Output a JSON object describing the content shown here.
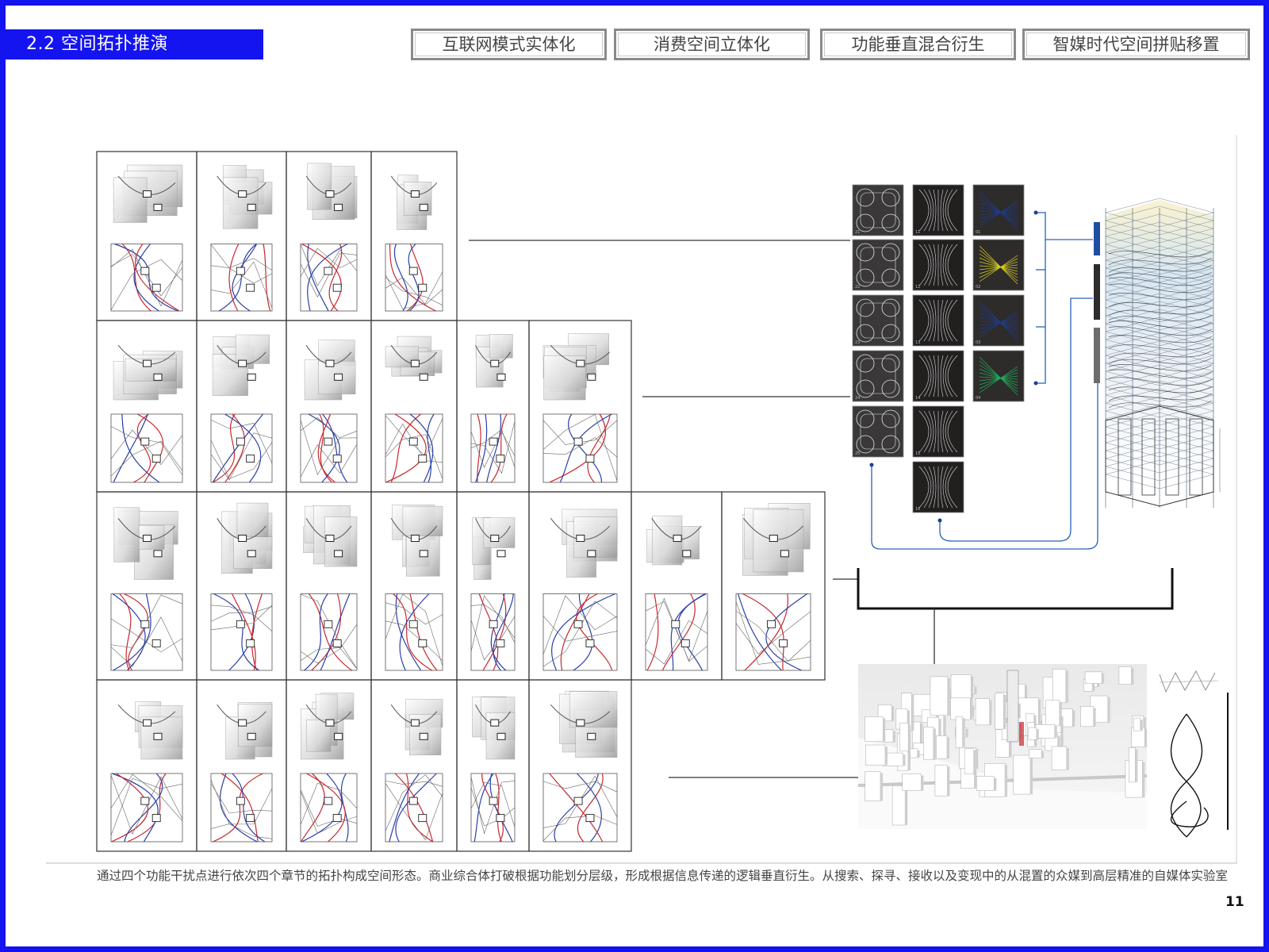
{
  "header": {
    "section_title": "2.2 空间拓扑推演",
    "tabs": [
      {
        "label": "互联网模式实体化"
      },
      {
        "label": "消费空间立体化"
      },
      {
        "label": "功能垂直混合衍生"
      },
      {
        "label": "智媒时代空间拼贴移置"
      }
    ]
  },
  "figure": {
    "matrix_rows": [
      4,
      6,
      8,
      6
    ],
    "tile_labels": {
      "col1": [
        "21",
        "22",
        "23",
        "24",
        "25"
      ],
      "col2": [
        "11",
        "12",
        "13",
        "14",
        "15",
        "16"
      ],
      "col3": [
        "01",
        "02",
        "03",
        "04"
      ]
    }
  },
  "caption": "通过四个功能干扰点进行依次四个章节的拓扑构成空间形态。商业综合体打破根据功能划分层级，形成根据信息传递的逻辑垂直衍生。从搜索、探寻、接收以及变现中的从混置的众媒到高层精准的自媒体实验室",
  "page_number": "11",
  "colors": {
    "accent": "#1414f0",
    "tab_border": "#8a8a8a",
    "tile_dark": "#2e2b2b",
    "tile_blue": "#1e3d8c",
    "tile_yellow": "#d8d020",
    "tile_green": "#1fae5a",
    "path_red": "#c8282e",
    "path_blue": "#2a3fa8"
  }
}
